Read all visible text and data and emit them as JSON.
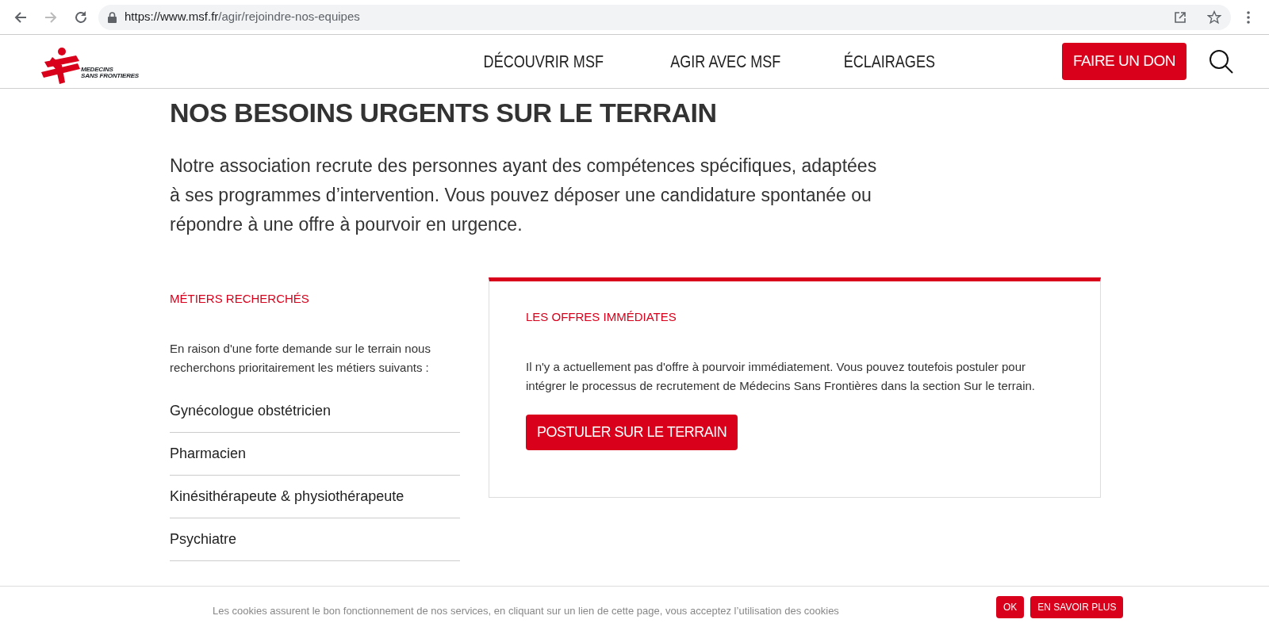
{
  "browser": {
    "url_host": "https://www.msf.fr",
    "url_path": "/agir/rejoindre-nos-equipes"
  },
  "logo": {
    "lines": [
      "MEDECINS",
      "SANS FRONTIERES"
    ]
  },
  "nav": {
    "items": [
      "DÉCOUVRIR MSF",
      "AGIR AVEC MSF",
      "ÉCLAIRAGES"
    ],
    "donate": "FAIRE UN DON"
  },
  "heading": "NOS BESOINS URGENTS SUR LE TERRAIN",
  "intro": "Notre association recrute des personnes ayant des compétences spécifiques, adaptées à ses programmes d’intervention. Vous pouvez déposer une candidature spontanée ou répondre à une offre à pourvoir en urgence.",
  "jobs": {
    "title": "MÉTIERS RECHERCHÉS",
    "text": "En raison d'une forte demande sur le terrain nous recherchons prioritairement les métiers suivants :",
    "items": [
      "Gynécologue obstétricien",
      "Pharmacien",
      "Kinésithérapeute & physiothérapeute",
      "Psychiatre"
    ]
  },
  "offers": {
    "title": "LES OFFRES IMMÉDIATES",
    "text": "Il n'y a actuellement pas d'offre à pourvoir immédiatement. Vous pouvez toutefois postuler pour intégrer le processus de recrutement de Médecins Sans Frontières dans la section Sur le terrain.",
    "button": "POSTULER SUR LE TERRAIN"
  },
  "cookie_bar": {
    "text": "Les cookies assurent le bon fonctionnement de nos services, en cliquant sur un lien de cette page, vous acceptez l’utilisation des cookies",
    "buttons": [
      "OK",
      "EN SAVOIR PLUS"
    ]
  }
}
